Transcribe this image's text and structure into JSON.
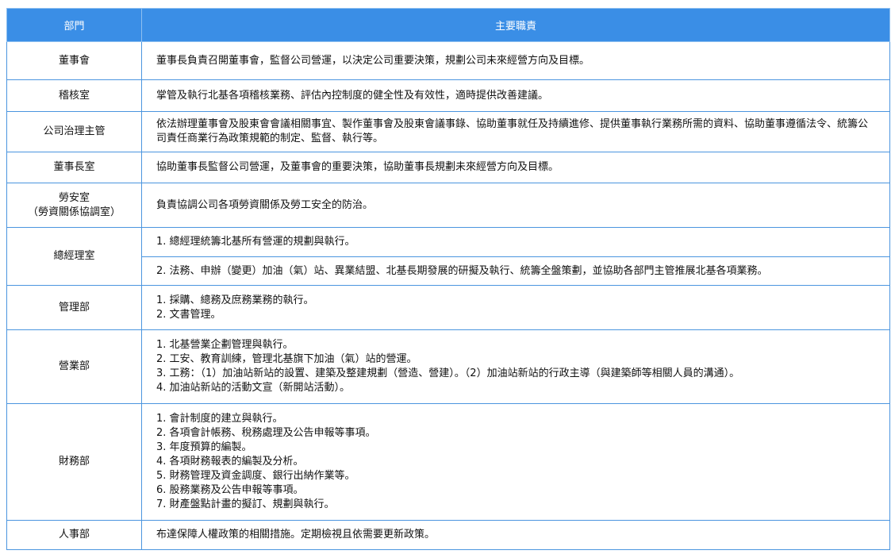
{
  "table": {
    "headers": [
      "部門",
      "主要職責"
    ],
    "rows": [
      {
        "dept": "董事會",
        "duties": [
          "董事長負責召開董事會，監督公司營運，以決定公司重要決策，規劃公司未來經營方向及目標。"
        ]
      },
      {
        "dept": "稽核室",
        "duties": [
          "掌管及執行北基各項稽核業務、評估內控制度的健全性及有效性，適時提供改善建議。"
        ]
      },
      {
        "dept": "公司治理主管",
        "duties": [
          "依法辦理董事會及股東會會議相關事宜、製作董事會及股東會議事錄、協助董事就任及持續進修、提供董事執行業務所需的資料、協助董事遵循法令、統籌公司責任商業行為政策規範的制定、監督、執行等。"
        ]
      },
      {
        "dept": "董事長室",
        "duties": [
          "協助董事長監督公司營運，及董事會的重要決策，協助董事長規劃未來經營方向及目標。"
        ]
      },
      {
        "dept": [
          "勞安室",
          "（勞資關係協調室）"
        ],
        "duties": [
          "負責協調公司各項勞資關係及勞工安全的防治。"
        ]
      },
      {
        "dept": "總經理室",
        "duties": [
          "1. 總經理統籌北基所有營運的規劃與執行。"
        ]
      },
      {
        "duties": [
          "2. 法務、申辦（變更）加油（氣）站、異業結盟、北基長期發展的研擬及執行、統籌全盤策劃，並協助各部門主管推展北基各項業務。"
        ]
      },
      {
        "dept": "管理部",
        "duties": [
          "1. 採購、總務及庶務業務的執行。",
          "2. 文書管理。"
        ]
      },
      {
        "dept": "營業部",
        "duties": [
          "1. 北基營業企劃管理與執行。",
          "2. 工安、教育訓練，管理北基旗下加油（氣）站的營運。",
          "3. 工務：（1）加油站新站的設置、建築及整建規劃（營造、營建）。（2）加油站新站的行政主導（與建築師等相關人員的溝通）。",
          "4. 加油站新站的活動文宣（新開站活動）。"
        ]
      },
      {
        "dept": "財務部",
        "duties": [
          "1. 會計制度的建立與執行。",
          "2. 各項會計帳務、稅務處理及公告申報等事項。",
          "3. 年度預算的編製。",
          "4. 各項財務報表的編製及分析。",
          "5. 財務管理及資金調度、銀行出納作業等。",
          "6. 股務業務及公告申報等事項。",
          "7. 財產盤點計畫的擬訂、規劃與執行。"
        ]
      },
      {
        "dept": "人事部",
        "duties": [
          "布達保障人權政策的相關措施。定期檢視且依需要更新政策。"
        ]
      }
    ]
  }
}
